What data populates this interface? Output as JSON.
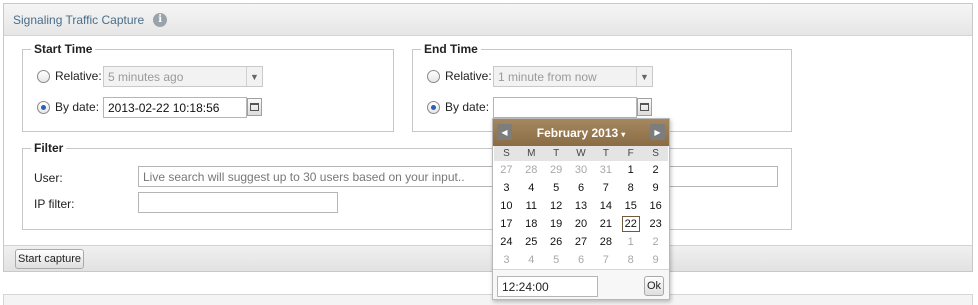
{
  "panel": {
    "title": "Signaling Traffic Capture",
    "info_icon": "info-icon"
  },
  "start_time": {
    "legend": "Start Time",
    "relative_label": "Relative:",
    "relative_value": "5 minutes ago",
    "by_date_label": "By date:",
    "by_date_value": "2013-02-22 10:18:56",
    "selected": "by_date"
  },
  "end_time": {
    "legend": "End Time",
    "relative_label": "Relative:",
    "relative_value": "1 minute from now",
    "by_date_label": "By date:",
    "by_date_value": "",
    "selected": "by_date"
  },
  "filter": {
    "legend": "Filter",
    "user_label": "User:",
    "user_placeholder": "Live search will suggest up to 30 users based on your input..",
    "ip_label": "IP filter:",
    "ip_value": ""
  },
  "footer": {
    "start_capture_label": "Start capture"
  },
  "datepicker": {
    "month_label": "February 2013",
    "caret": "▾",
    "prev_icon": "◀",
    "next_icon": "▶",
    "weekdays": [
      "S",
      "M",
      "T",
      "W",
      "T",
      "F",
      "S"
    ],
    "weeks": [
      [
        {
          "d": "27",
          "o": true
        },
        {
          "d": "28",
          "o": true
        },
        {
          "d": "29",
          "o": true
        },
        {
          "d": "30",
          "o": true
        },
        {
          "d": "31",
          "o": true
        },
        {
          "d": "1"
        },
        {
          "d": "2"
        }
      ],
      [
        {
          "d": "3"
        },
        {
          "d": "4"
        },
        {
          "d": "5"
        },
        {
          "d": "6"
        },
        {
          "d": "7"
        },
        {
          "d": "8"
        },
        {
          "d": "9"
        }
      ],
      [
        {
          "d": "10"
        },
        {
          "d": "11"
        },
        {
          "d": "12"
        },
        {
          "d": "13"
        },
        {
          "d": "14"
        },
        {
          "d": "15"
        },
        {
          "d": "16"
        }
      ],
      [
        {
          "d": "17"
        },
        {
          "d": "18"
        },
        {
          "d": "19"
        },
        {
          "d": "20"
        },
        {
          "d": "21"
        },
        {
          "d": "22",
          "s": true
        },
        {
          "d": "23"
        }
      ],
      [
        {
          "d": "24"
        },
        {
          "d": "25"
        },
        {
          "d": "26"
        },
        {
          "d": "27"
        },
        {
          "d": "28"
        },
        {
          "d": "1",
          "o": true
        },
        {
          "d": "2",
          "o": true
        }
      ],
      [
        {
          "d": "3",
          "o": true
        },
        {
          "d": "4",
          "o": true
        },
        {
          "d": "5",
          "o": true
        },
        {
          "d": "6",
          "o": true
        },
        {
          "d": "7",
          "o": true
        },
        {
          "d": "8",
          "o": true
        },
        {
          "d": "9",
          "o": true
        }
      ]
    ],
    "time_value": "12:24:00",
    "ok_label": "Ok"
  },
  "colors": {
    "picker_header": "#8a6d45",
    "title_text": "#4a6e8a",
    "radio_dot": "#2d5fb8"
  }
}
